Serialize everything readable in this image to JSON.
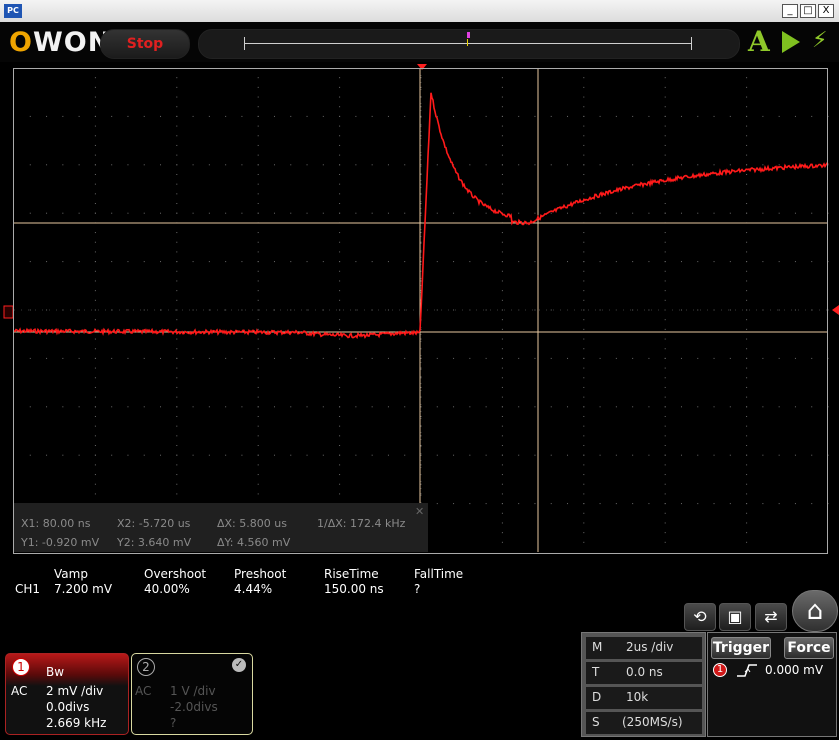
{
  "window": {
    "app_icon_text": "PC",
    "minimize_glyph": "_",
    "maximize_glyph": "□",
    "close_glyph": "X"
  },
  "toolbar": {
    "logo_text": "OWON",
    "stop_label": "Stop",
    "auto_label": "A",
    "icons": [
      "autoset-icon",
      "run-icon",
      "lightning-icon"
    ]
  },
  "colors": {
    "trace": "#ff1a1a",
    "grid": "#6a6a6a",
    "cursor_line": "#e8c8a0",
    "stop_text": "#e02020",
    "accent_green": "#8fc82a"
  },
  "cursor_readout": {
    "x1": "X1: 80.00 ns",
    "x2": "X2: -5.720 us",
    "dx": "ΔX: 5.800 us",
    "inv_dx": "1/ΔX: 172.4 kHz",
    "y1": "Y1: -0.920 mV",
    "y2": "Y2: 3.640 mV",
    "dy": "ΔY: 4.560 mV",
    "close_glyph": "✕"
  },
  "measurements": {
    "channel": "CH1",
    "headers": [
      "Vamp",
      "Overshoot",
      "Preshoot",
      "RiseTime",
      "FallTime"
    ],
    "values": [
      "7.200 mV",
      "40.00%",
      "4.44%",
      "150.00 ns",
      "?"
    ]
  },
  "shortcuts": [
    "reset-icon",
    "save-icon",
    "swap-icon",
    "home-icon"
  ],
  "ch1": {
    "number": "1",
    "bw": "Bw",
    "coupling": "AC",
    "scale": "2 mV /div",
    "offset": "0.0divs",
    "freq": "2.669 kHz"
  },
  "ch2": {
    "number": "2",
    "coupling": "AC",
    "scale": "1 V /div",
    "offset": "-2.0divs",
    "freq": "?",
    "enabled_glyph": "✓"
  },
  "horizontal": {
    "rows": [
      {
        "key": "M",
        "value": "2us /div"
      },
      {
        "key": "T",
        "value": "0.0 ns"
      },
      {
        "key": "D",
        "value": "10k"
      },
      {
        "key": "S",
        "value": "(250MS/s)"
      }
    ]
  },
  "trigger": {
    "trigger_label": "Trigger",
    "force_label": "Force",
    "source": "1",
    "level": "0.000 mV"
  }
}
